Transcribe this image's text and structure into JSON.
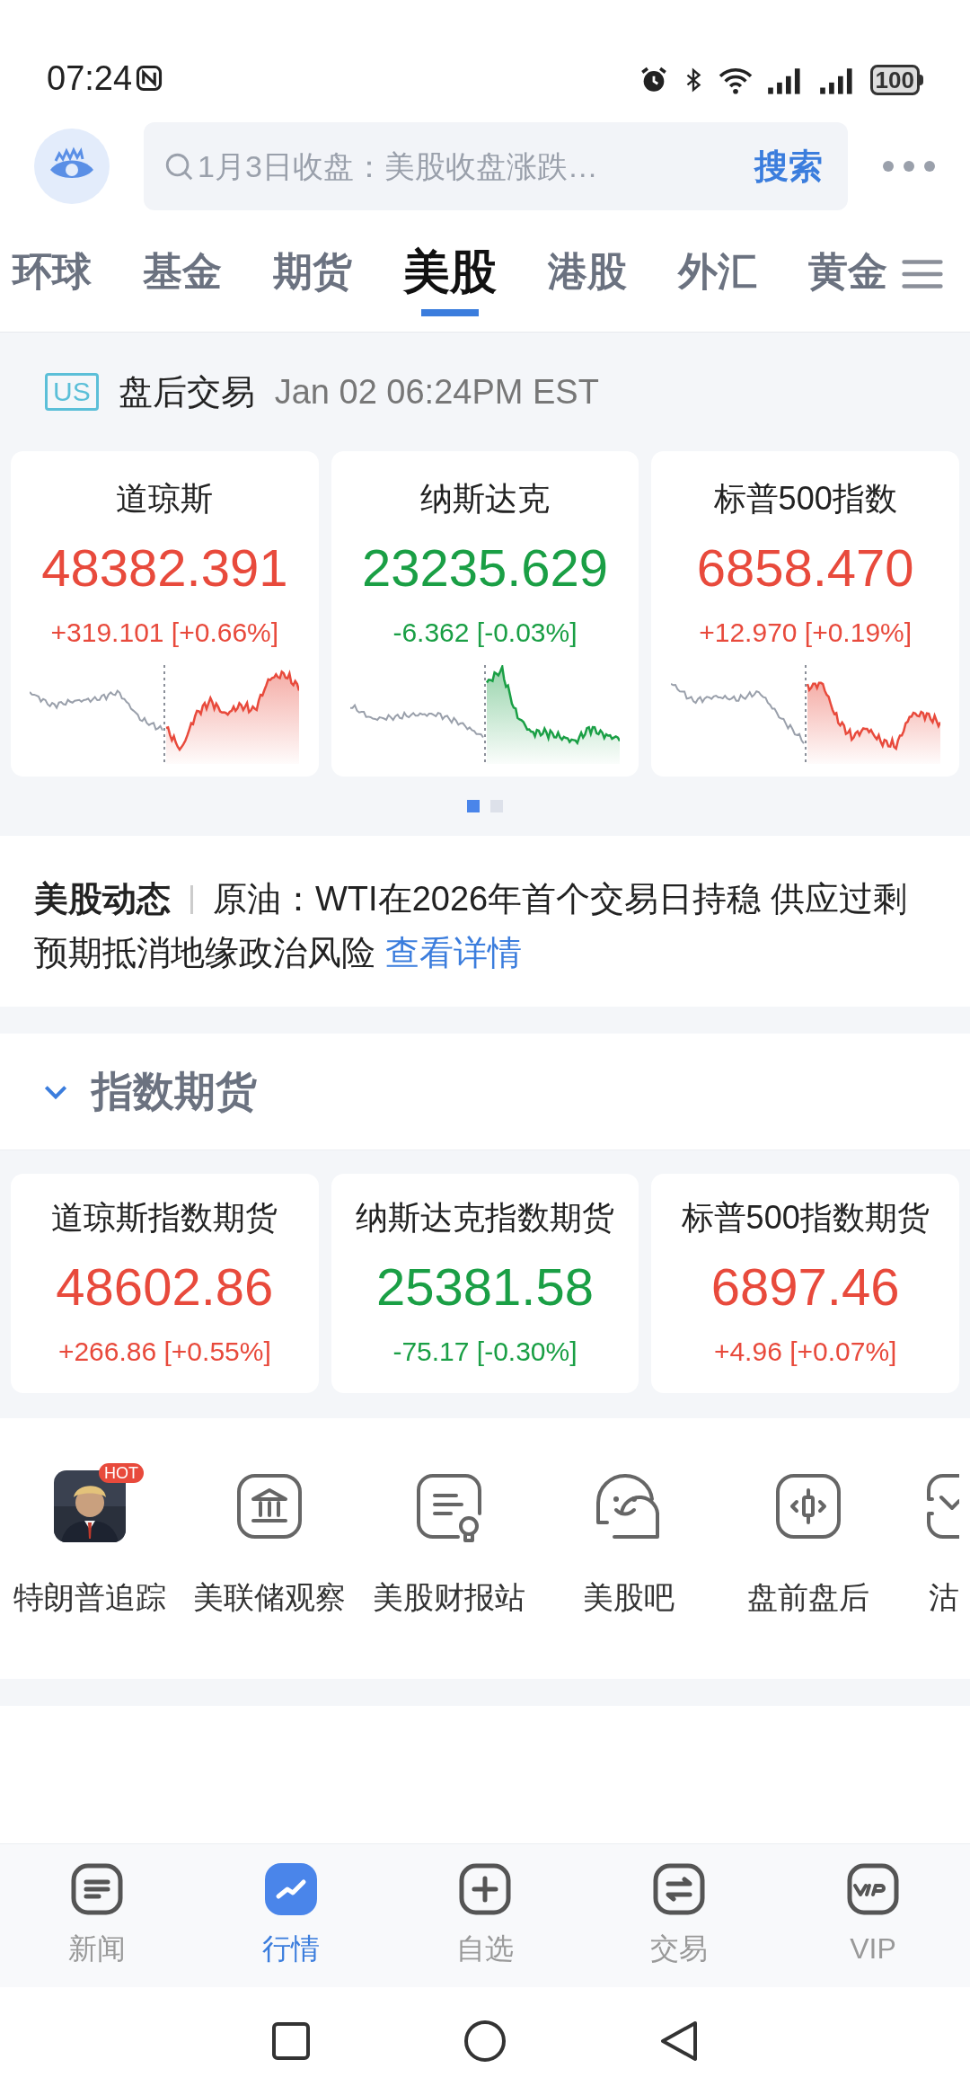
{
  "status_bar": {
    "time": "07:24",
    "battery": "100"
  },
  "search": {
    "placeholder": "1月3日收盘：美股收盘涨跌…",
    "button": "搜索"
  },
  "tabs": [
    {
      "label": "环球",
      "selected": false
    },
    {
      "label": "基金",
      "selected": false
    },
    {
      "label": "期货",
      "selected": false
    },
    {
      "label": "美股",
      "selected": true
    },
    {
      "label": "港股",
      "selected": false
    },
    {
      "label": "外汇",
      "selected": false
    },
    {
      "label": "黄金",
      "selected": false
    }
  ],
  "session": {
    "badge": "US",
    "label": "盘后交易",
    "time": "Jan 02 06:24PM EST"
  },
  "indices": [
    {
      "name": "道琼斯",
      "price": "48382.391",
      "change": "+319.101 [+0.66%]",
      "color": "#e84a3c"
    },
    {
      "name": "纳斯达克",
      "price": "23235.629",
      "change": "-6.362 [-0.03%]",
      "color": "#1a9f45"
    },
    {
      "name": "标普500指数",
      "price": "6858.470",
      "change": "+12.970 [+0.19%]",
      "color": "#e84a3c"
    }
  ],
  "pager": [
    {
      "selected": true
    },
    {
      "selected": false
    }
  ],
  "news": {
    "tag": "美股动态",
    "text": "原油：WTI在2026年首个交易日持稳 供应过剩预期抵消地缘政治风险",
    "link": "查看详情"
  },
  "futures_section": {
    "title": "指数期货",
    "expanded": true
  },
  "futures": [
    {
      "name": "道琼斯指数期货",
      "price": "48602.86",
      "change": "+266.86 [+0.55%]",
      "color": "#e84a3c"
    },
    {
      "name": "纳斯达克指数期货",
      "price": "25381.58",
      "change": "-75.17 [-0.30%]",
      "color": "#1a9f45"
    },
    {
      "name": "标普500指数期货",
      "price": "6897.46",
      "change": "+4.96 [+0.07%]",
      "color": "#e84a3c"
    }
  ],
  "shortcuts": [
    {
      "label": "特朗普追踪",
      "kind": "picture",
      "badge": "HOT"
    },
    {
      "label": "美联储观察",
      "kind": "bank"
    },
    {
      "label": "美股财报站",
      "kind": "report"
    },
    {
      "label": "美股吧",
      "kind": "chat"
    },
    {
      "label": "盘前盘后",
      "kind": "candle"
    },
    {
      "label": "沽",
      "kind": "cut"
    }
  ],
  "bottom_nav": [
    {
      "label": "新闻",
      "selected": false
    },
    {
      "label": "行情",
      "selected": true
    },
    {
      "label": "自选",
      "selected": false
    },
    {
      "label": "交易",
      "selected": false
    },
    {
      "label": "VIP",
      "selected": false
    }
  ]
}
